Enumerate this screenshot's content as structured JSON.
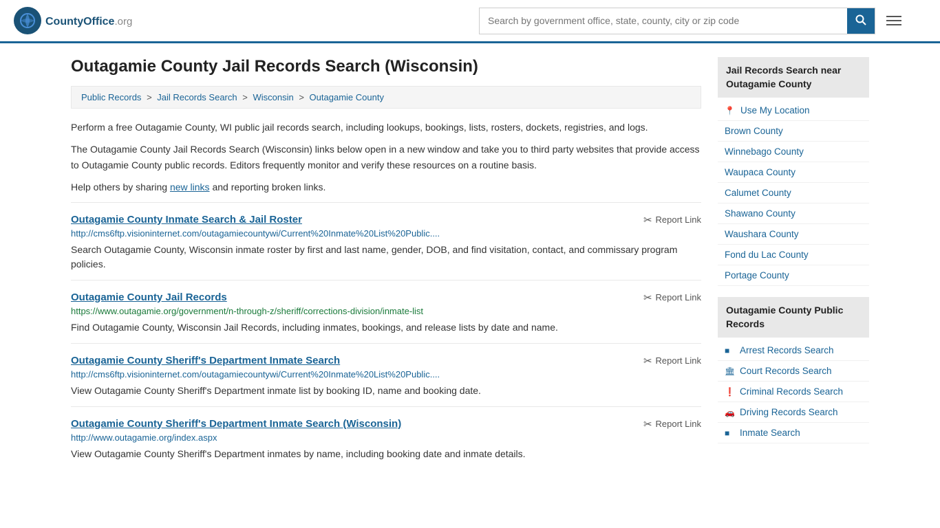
{
  "header": {
    "logo_text": "CountyOffice",
    "logo_suffix": ".org",
    "search_placeholder": "Search by government office, state, county, city or zip code",
    "search_value": ""
  },
  "page": {
    "title": "Outagamie County Jail Records Search (Wisconsin)",
    "breadcrumbs": [
      {
        "label": "Public Records",
        "href": "#"
      },
      {
        "label": "Jail Records Search",
        "href": "#"
      },
      {
        "label": "Wisconsin",
        "href": "#"
      },
      {
        "label": "Outagamie County",
        "href": "#"
      }
    ],
    "description1": "Perform a free Outagamie County, WI public jail records search, including lookups, bookings, lists, rosters, dockets, registries, and logs.",
    "description2": "The Outagamie County Jail Records Search (Wisconsin) links below open in a new window and take you to third party websites that provide access to Outagamie County public records. Editors frequently monitor and verify these resources on a routine basis.",
    "description3_pre": "Help others by sharing ",
    "description3_link": "new links",
    "description3_post": " and reporting broken links.",
    "results": [
      {
        "title": "Outagamie County Inmate Search & Jail Roster",
        "url": "http://cms6ftp.visioninternet.com/outagamiecountywi/Current%20Inmate%20List%20Public....",
        "url_color": "blue",
        "description": "Search Outagamie County, Wisconsin inmate roster by first and last name, gender, DOB, and find visitation, contact, and commissary program policies.",
        "report_label": "Report Link"
      },
      {
        "title": "Outagamie County Jail Records",
        "url": "https://www.outagamie.org/government/n-through-z/sheriff/corrections-division/inmate-list",
        "url_color": "green",
        "description": "Find Outagamie County, Wisconsin Jail Records, including inmates, bookings, and release lists by date and name.",
        "report_label": "Report Link"
      },
      {
        "title": "Outagamie County Sheriff's Department Inmate Search",
        "url": "http://cms6ftp.visioninternet.com/outagamiecountywi/Current%20Inmate%20List%20Public....",
        "url_color": "blue",
        "description": "View Outagamie County Sheriff's Department inmate list by booking ID, name and booking date.",
        "report_label": "Report Link"
      },
      {
        "title": "Outagamie County Sheriff's Department Inmate Search (Wisconsin)",
        "url": "http://www.outagamie.org/index.aspx",
        "url_color": "blue",
        "description": "View Outagamie County Sheriff's Department inmates by name, including booking date and inmate details.",
        "report_label": "Report Link"
      }
    ]
  },
  "sidebar": {
    "nearby_title": "Jail Records Search near Outagamie County",
    "nearby_links": [
      {
        "label": "Use My Location",
        "icon": "📍"
      },
      {
        "label": "Brown County"
      },
      {
        "label": "Winnebago County"
      },
      {
        "label": "Waupaca County"
      },
      {
        "label": "Calumet County"
      },
      {
        "label": "Shawano County"
      },
      {
        "label": "Waushara County"
      },
      {
        "label": "Fond du Lac County"
      },
      {
        "label": "Portage County"
      }
    ],
    "public_records_title": "Outagamie County Public Records",
    "public_records_links": [
      {
        "label": "Arrest Records Search",
        "icon": "■"
      },
      {
        "label": "Court Records Search",
        "icon": "🏛"
      },
      {
        "label": "Criminal Records Search",
        "icon": "❗"
      },
      {
        "label": "Driving Records Search",
        "icon": "🚗"
      },
      {
        "label": "Inmate Search",
        "icon": "■"
      }
    ]
  }
}
